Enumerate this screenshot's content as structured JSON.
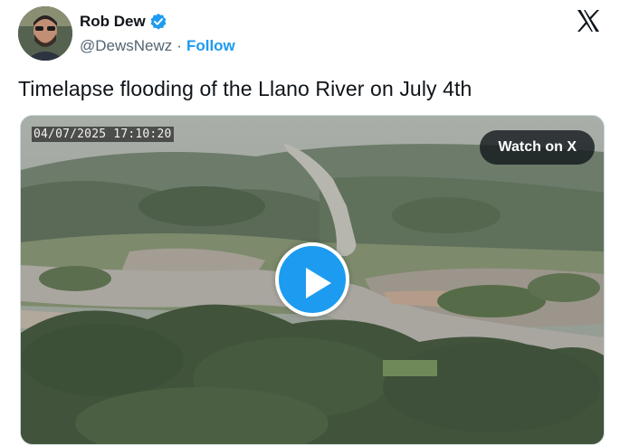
{
  "author": {
    "name": "Rob Dew",
    "handle": "@DewsNewz",
    "separator": "·",
    "follow_label": "Follow",
    "verified": true
  },
  "tweet": {
    "text": "Timelapse flooding of the Llano River on July 4th"
  },
  "media": {
    "timestamp": "04/07/2025 17:10:20",
    "watch_label": "Watch on X",
    "play_icon": "play-icon"
  },
  "icons": {
    "verified": "verified-badge-icon",
    "platform": "x-logo-icon"
  },
  "colors": {
    "accent": "#1d9bf0",
    "text": "#0f1419",
    "secondary": "#536471"
  }
}
